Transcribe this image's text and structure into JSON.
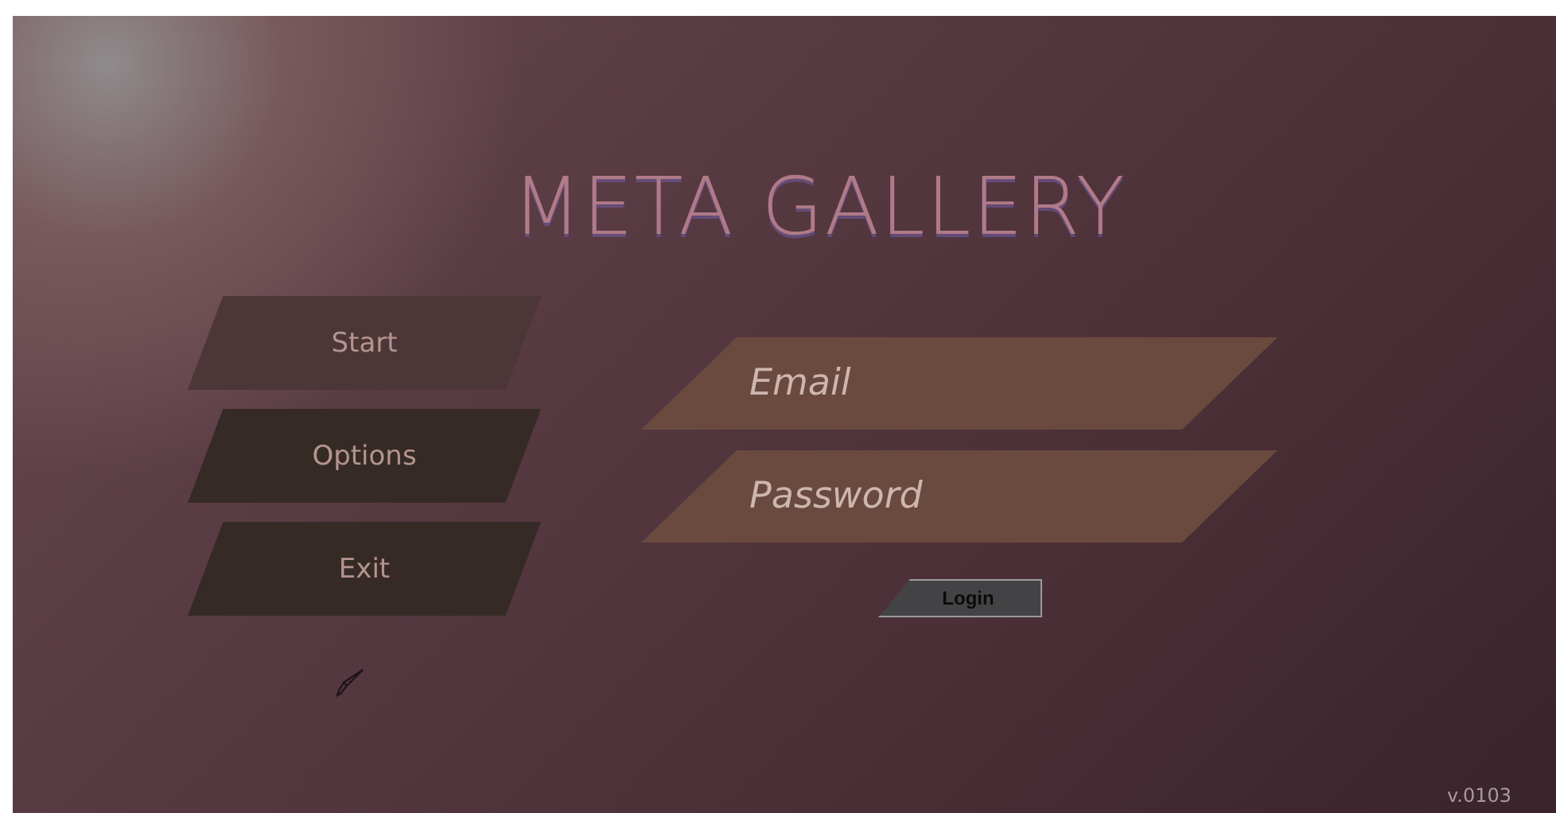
{
  "title": "META GALLERY",
  "menu": [
    {
      "label": "Start",
      "selected": true
    },
    {
      "label": "Options",
      "selected": false
    },
    {
      "label": "Exit",
      "selected": false
    }
  ],
  "login_form": {
    "fields": [
      {
        "placeholder": "Email"
      },
      {
        "placeholder": "Password"
      }
    ],
    "button": "Login"
  },
  "version": "v.0103"
}
